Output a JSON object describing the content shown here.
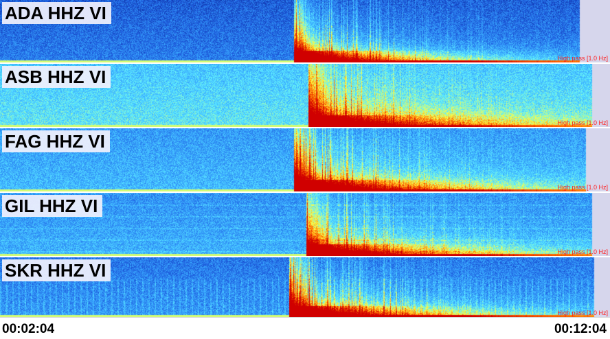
{
  "chart_data": {
    "type": "heatmap",
    "title": "",
    "time_axis": {
      "start": "00:02:04",
      "end": "00:12:04"
    },
    "colormap": [
      "#08208f",
      "#1f5fe0",
      "#39a9ff",
      "#5ff0ff",
      "#ffff40",
      "#ff6a00",
      "#d00000"
    ],
    "panels": [
      {
        "station": "ADA HHZ VI",
        "filter": "High pass [1.0 Hz]",
        "onset_time": "00:06:53",
        "data_end_time": "00:11:34",
        "base_level": 0.16,
        "event_strength": 1.0
      },
      {
        "station": "ASB HHZ VI",
        "filter": "High pass [1.0 Hz]",
        "onset_time": "00:07:07",
        "data_end_time": "00:11:46",
        "base_level": 0.4,
        "event_strength": 0.85
      },
      {
        "station": "FAG HHZ VI",
        "filter": "High pass [1.0 Hz]",
        "onset_time": "00:06:53",
        "data_end_time": "00:11:40",
        "base_level": 0.3,
        "event_strength": 1.0
      },
      {
        "station": "GIL HHZ VI",
        "filter": "High pass [1.0 Hz]",
        "onset_time": "00:07:05",
        "data_end_time": "00:11:46",
        "base_level": 0.28,
        "event_strength": 0.9
      },
      {
        "station": "SKR HHZ VI",
        "filter": "High pass [1.0 Hz]",
        "onset_time": "00:06:48",
        "data_end_time": "00:11:48",
        "base_level": 0.22,
        "event_strength": 1.0
      }
    ]
  }
}
